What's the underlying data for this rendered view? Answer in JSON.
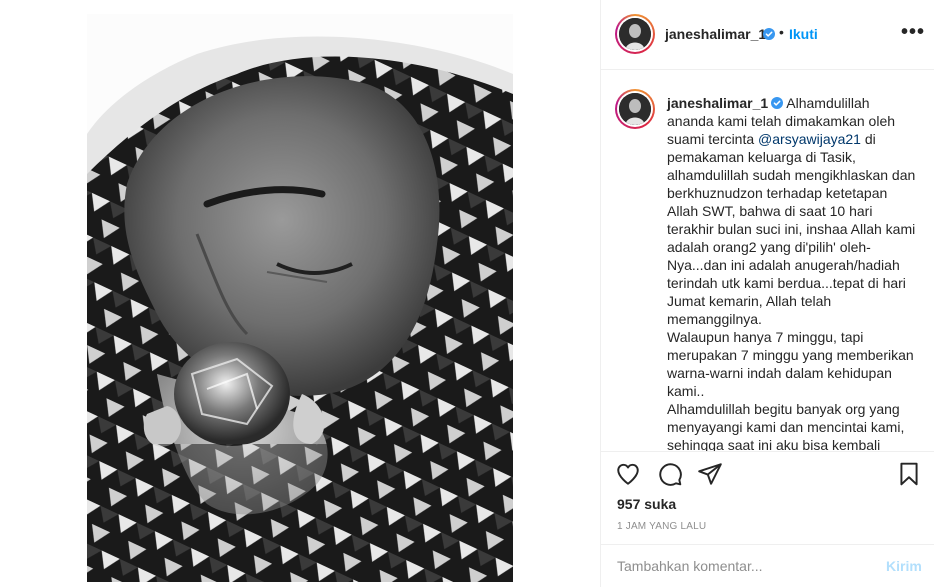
{
  "post": {
    "username": "janeshalimar_1",
    "follow_label": "Ikuti",
    "dot": "•",
    "more_label": "•••",
    "caption_part1": " Alhamdulillah ananda kami telah dimakamkan oleh suami tercinta ",
    "mention": "@arsyawijaya21",
    "caption_part2": " di pemakaman keluarga di Tasik, alhamdulillah sudah mengikhlaskan dan berkhuznudzon terhadap ketetapan Allah SWT, bahwa di saat 10 hari terakhir bulan suci ini, inshaa Allah kami adalah orang2 yang di'pilih' oleh-Nya...dan ini adalah anugerah/hadiah terindah utk kami berdua...tepat di hari Jumat kemarin, Allah telah memanggilnya.",
    "caption_part3": "Walaupun hanya 7 minggu, tapi merupakan 7 minggu yang memberikan warna-warni indah dalam kehidupan kami..",
    "caption_part4": "Alhamdulillah begitu banyak org yang menyayangi kami dan mencintai kami, sehingga saat ini aku bisa kembali",
    "likes": "957 suka",
    "time_ago": "1 JAM YANG LALU"
  },
  "comment_form": {
    "placeholder": "Tambahkan komentar...",
    "post_label": "Kirim"
  },
  "icons": {
    "like": "heart-icon",
    "comment": "comment-icon",
    "share": "paper-plane-icon",
    "save": "bookmark-icon",
    "verified": "verified-badge-icon"
  },
  "colors": {
    "link_blue": "#0095f6",
    "mention": "#00376b",
    "post_disabled": "#b2dffc",
    "verified": "#3897f0"
  }
}
